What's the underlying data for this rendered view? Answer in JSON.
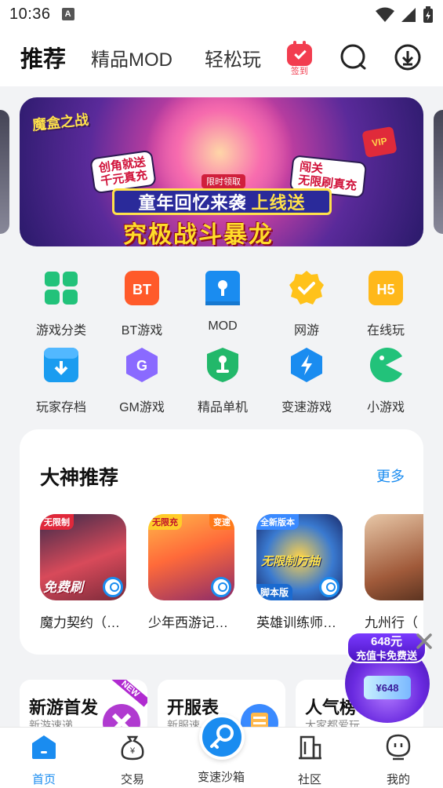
{
  "status_bar": {
    "time": "10:36",
    "notif_letter": "A"
  },
  "top_nav": {
    "tabs": [
      {
        "label": "推荐",
        "active": true
      },
      {
        "label": "精品MOD",
        "active": false
      },
      {
        "label": "轻松玩",
        "active": false
      }
    ],
    "signin_label": "签到",
    "icons": [
      "calendar-check-icon",
      "search-icon",
      "download-icon"
    ]
  },
  "banner": {
    "logo": "魔盒之战",
    "bubble_left": "创角就送\n千元真充",
    "bubble_right": "闯关\n无限刷真充",
    "limited": "限时领取",
    "title_main": "童年回忆来袭",
    "title_hl": "上线送",
    "big_text": "究极战斗暴龙",
    "vip": "VIP"
  },
  "categories": [
    {
      "label": "游戏分类",
      "icon": "grid-icon",
      "color": "#22c27a"
    },
    {
      "label": "BT游戏",
      "icon": "bt-icon",
      "color": "#ff5a2a"
    },
    {
      "label": "MOD",
      "icon": "mod-icon",
      "color": "#1a8cf0"
    },
    {
      "label": "网游",
      "icon": "check-badge-icon",
      "color": "#ffc21a"
    },
    {
      "label": "在线玩",
      "icon": "h5-icon",
      "color": "#ffb81a"
    },
    {
      "label": "玩家存档",
      "icon": "save-box-icon",
      "color": "#1a9cf0"
    },
    {
      "label": "GM游戏",
      "icon": "gm-hexagon-icon",
      "color": "#8a6aff"
    },
    {
      "label": "精品单机",
      "icon": "joystick-shield-icon",
      "color": "#22b86a"
    },
    {
      "label": "变速游戏",
      "icon": "bolt-hexagon-icon",
      "color": "#1a8cf0"
    },
    {
      "label": "小游戏",
      "icon": "pacman-icon",
      "color": "#22c27a"
    }
  ],
  "featured": {
    "title": "大神推荐",
    "more": "更多",
    "games": [
      {
        "name": "魔力契约（…",
        "corner": "无限制",
        "tag": "免费刷"
      },
      {
        "name": "少年西游记…",
        "corner": "无限充",
        "tag": "变速"
      },
      {
        "name": "英雄训练师…",
        "corner": "全新版本",
        "tag": "无限制万抽",
        "sub": "脚本版"
      },
      {
        "name": "九州行（"
      }
    ]
  },
  "mini_cards": [
    {
      "title": "新游首发",
      "sub": "新游速递",
      "badge": "NEW"
    },
    {
      "title": "开服表",
      "sub": "新服速"
    },
    {
      "title": "人气榜",
      "sub": "大家都爱玩"
    }
  ],
  "promo": {
    "ribbon_line1": "648元",
    "ribbon_line2": "充值卡免费送",
    "card": "¥648"
  },
  "tab_bar": {
    "items": [
      {
        "label": "首页",
        "active": true
      },
      {
        "label": "交易",
        "active": false
      },
      {
        "label": "变速沙箱",
        "active": false
      },
      {
        "label": "社区",
        "active": false
      },
      {
        "label": "我的",
        "active": false
      }
    ]
  },
  "colors": {
    "accent": "#1a8cf0",
    "signin_red": "#f23d4f"
  }
}
